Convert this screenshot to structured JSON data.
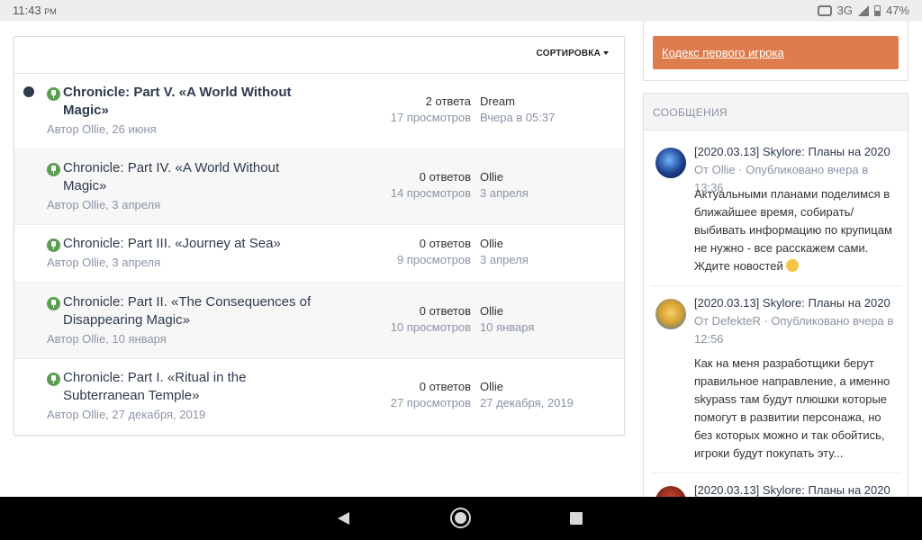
{
  "status_bar": {
    "time": "11:43",
    "ampm": "PM",
    "network": "3G",
    "battery": "47%"
  },
  "topics": {
    "sort_label": "СОРТИРОВКА",
    "rows": [
      {
        "title": "Chronicle: Part V. «A World Without Magic»",
        "author": "Автор Ollie, 26 июня",
        "replies": "2 ответа",
        "views": "17 просмотров",
        "last_user": "Dream",
        "last_date": "Вчера в 05:37",
        "unread": true
      },
      {
        "title": "Chronicle: Part IV. «A World Without Magic»",
        "author": "Автор Ollie, 3 апреля",
        "replies": "0 ответов",
        "views": "14 просмотров",
        "last_user": "Ollie",
        "last_date": "3 апреля",
        "unread": false
      },
      {
        "title": "Chronicle: Part III. «Journey at Sea»",
        "author": "Автор Ollie, 3 апреля",
        "replies": "0 ответов",
        "views": "9 просмотров",
        "last_user": "Ollie",
        "last_date": "3 апреля",
        "unread": false
      },
      {
        "title": "Chronicle: Part II. «The Consequences of Disappearing Magic»",
        "author": "Автор Ollie, 10 января",
        "replies": "0 ответов",
        "views": "10 просмотров",
        "last_user": "Ollie",
        "last_date": "10 января",
        "unread": false
      },
      {
        "title": "Chronicle: Part I. «Ritual in the Subterranean Temple»",
        "author": "Автор Ollie, 27 декабря, 2019",
        "replies": "0 ответов",
        "views": "27 просмотров",
        "last_user": "Ollie",
        "last_date": "27 декабря, 2019",
        "unread": false
      }
    ]
  },
  "sidebar": {
    "code_button": "Кодекс первого игрока",
    "messages_header": "СООБЩЕНИЯ",
    "messages": [
      {
        "title": "[2020.03.13] Skylore: Планы на 2020",
        "meta": "От Ollie · Опубликовано вчера в 13:36",
        "body": "Актуальными планами поделимся в ближайшее время, собирать/выбивать информацию по крупицам не нужно - все расскажем сами. Ждите новостей",
        "avatar_color": "#1c3f8c"
      },
      {
        "title": "[2020.03.13] Skylore: Планы на 2020",
        "meta": "От DefekteR · Опубликовано вчера в 12:56",
        "body": "Как на меня разработщики берут правильное направление, а именно skypass там будут плюшки которые помогут в развитии персонажа, но без которых можно и так обойтись, игроки будут покупать эту...",
        "avatar_color": "#d8a331"
      },
      {
        "title": "[2020.03.13] Skylore: Планы на 2020",
        "meta": "",
        "body": "",
        "avatar_color": "#8c2a1c"
      }
    ]
  }
}
